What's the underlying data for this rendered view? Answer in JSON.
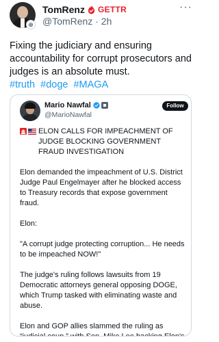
{
  "post": {
    "display_name": "TomRenz",
    "platform_label": "GETTR",
    "handle": "@TomRenz",
    "time": "2h",
    "handle_time": "@TomRenz · 2h",
    "more_glyph": "···",
    "text": "Fixing the judiciary and ensuring accountability for corrupt prosecutors and judges is an absolute must.",
    "hashtags": [
      "#truth",
      "#doge",
      "#MAGA"
    ]
  },
  "quote": {
    "display_name": "Mario Nawfal",
    "handle": "@MarioNawfal",
    "follow_label": "Follow",
    "headline": "ELON CALLS FOR IMPEACHMENT OF JUDGE BLOCKING GOVERNMENT FRAUD INVESTIGATION",
    "paragraphs": [
      "Elon demanded the impeachment of U.S. District Judge Paul Engelmayer after he blocked access to Treasury records that expose government fraud.",
      "Elon:",
      "\"A corrupt judge protecting corruption... He needs to be impeached NOW!\"",
      "The judge's ruling follows lawsuits from 19 Democratic attorneys general opposing DOGE, which Trump tasked with eliminating waste and abuse.",
      "Elon and GOP allies slammed the ruling as “judicial coup,” with Sen. Mike Lee backing Elon's call for removing corrupt judges."
    ]
  },
  "colors": {
    "gettr_red": "#e8202d",
    "link_blue": "#1d9bf0",
    "verified_blue": "#1d9bf0",
    "text": "#0f1419",
    "muted": "#536471",
    "border": "#cfd9de"
  },
  "icons": {
    "gettr": "flame-check-icon",
    "verified": "verified-badge-icon",
    "siren": "siren-icon",
    "flag": "us-flag-icon"
  }
}
